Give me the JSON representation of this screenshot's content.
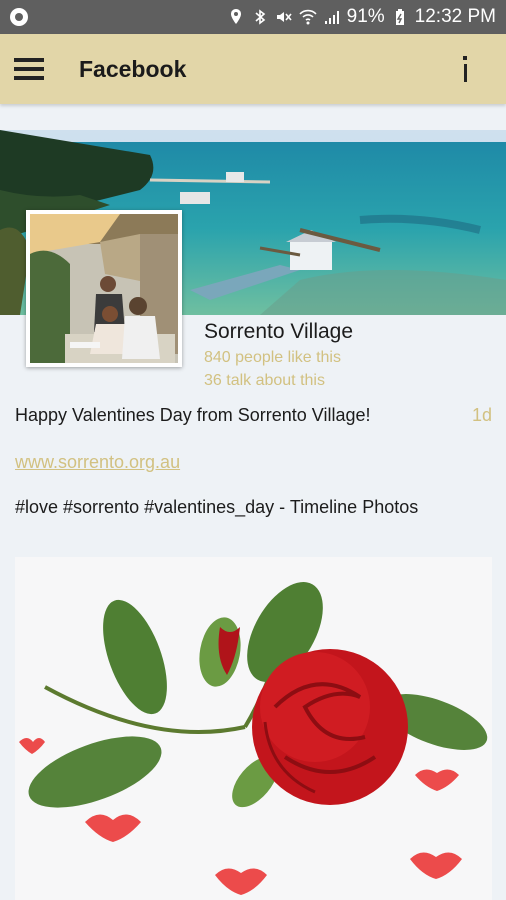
{
  "status_bar": {
    "battery": "91%",
    "time": "12:32 PM"
  },
  "app_bar": {
    "title": "Facebook",
    "menu_icon": "hamburger-menu-icon",
    "info_icon": "info-icon"
  },
  "page": {
    "name": "Sorrento Village",
    "likes": "840 people like this",
    "talking": "36 talk about this"
  },
  "post": {
    "text": "Happy Valentines Day from Sorrento Village!",
    "time": "1d",
    "link": "www.sorrento.org.au",
    "tags": "#love #sorrento #valentines_day - Timeline Photos"
  },
  "colors": {
    "app_bar": "#e2d6a8",
    "accent_text": "#d2c181",
    "status_bar": "#5f5f5f"
  }
}
